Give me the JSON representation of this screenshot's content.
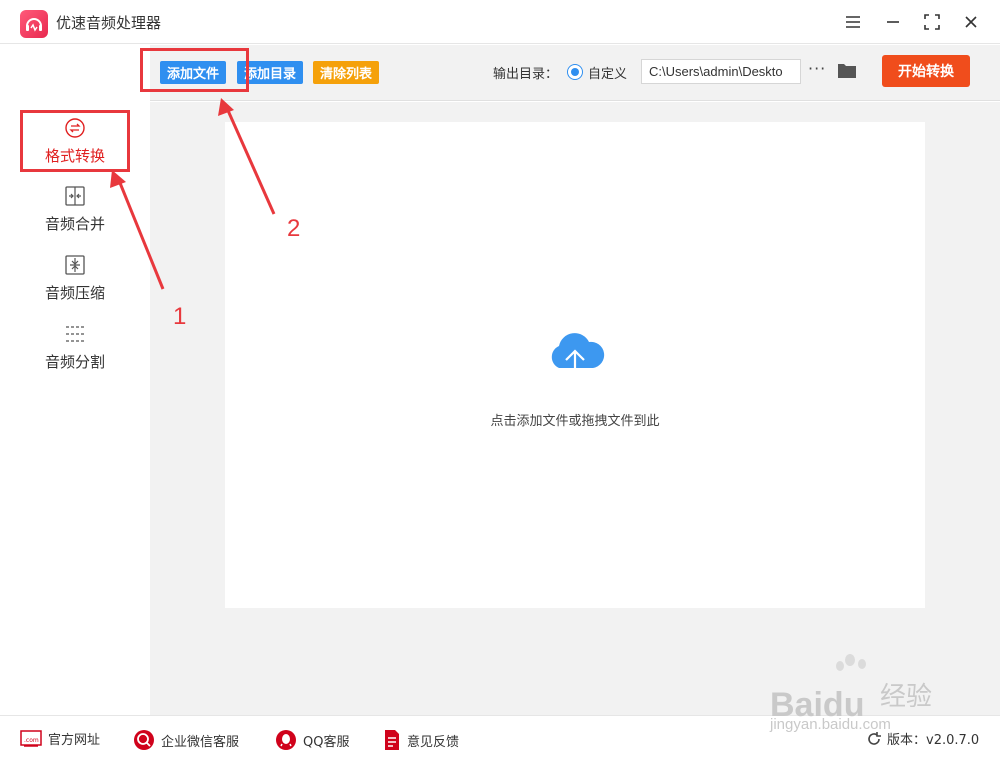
{
  "app": {
    "title": "优速音频处理器"
  },
  "sidebar": {
    "items": [
      {
        "label": "格式转换",
        "icon": "format-convert-icon",
        "active": true
      },
      {
        "label": "音频合并",
        "icon": "audio-merge-icon",
        "active": false
      },
      {
        "label": "音频压缩",
        "icon": "audio-compress-icon",
        "active": false
      },
      {
        "label": "音频分割",
        "icon": "audio-split-icon",
        "active": false
      }
    ]
  },
  "toolbar": {
    "add_file": "添加文件",
    "add_folder": "添加目录",
    "clear_list": "清除列表",
    "output_label": "输出目录：",
    "custom_label": "自定义",
    "output_path": "C:\\Users\\admin\\Deskto",
    "more": "···",
    "start": "开始转换"
  },
  "main": {
    "drop_hint": "点击添加文件或拖拽文件到此"
  },
  "annotations": {
    "one": "1",
    "two": "2"
  },
  "footer": {
    "website": "官方网址",
    "wechat": "企业微信客服",
    "qq": "QQ客服",
    "feedback": "意见反馈",
    "version": "版本：v2.0.7.0"
  },
  "watermark": {
    "brand": "Bai",
    "brand2": "du",
    "cn": "经验",
    "url": "jingyan.baidu.com"
  },
  "colors": {
    "blue": "#2f8ff0",
    "orange": "#f5a10a",
    "start": "#f04d1c",
    "annotation": "#e8383d"
  }
}
